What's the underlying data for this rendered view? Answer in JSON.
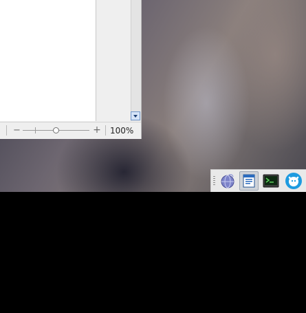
{
  "document_window": {
    "zoom_minus": "−",
    "zoom_plus": "+",
    "zoom_level": "100%",
    "zoom_slider_fraction": 0.5
  },
  "taskbar": {
    "icons": [
      "browser-icon",
      "writer-document-icon",
      "terminal-icon",
      "messenger-icon"
    ],
    "active_index": 1
  }
}
